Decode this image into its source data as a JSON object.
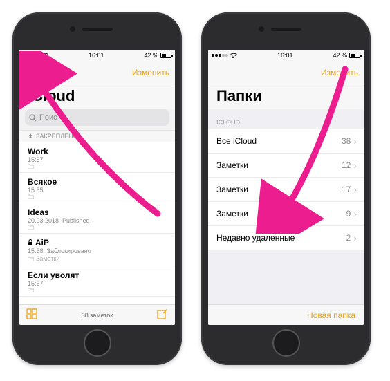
{
  "status": {
    "time": "16:01",
    "battery": "42 %"
  },
  "left": {
    "nav": {
      "edit": "Изменить"
    },
    "title": "iCloud",
    "search": {
      "placeholder": "Поис"
    },
    "pinned_header": "ЗАКРЕПЛЕНО",
    "notes": [
      {
        "title": "Work",
        "time": "15:57",
        "extra": "",
        "locked": false
      },
      {
        "title": "Всякое",
        "time": "15:55",
        "extra": "",
        "locked": false
      },
      {
        "title": "Ideas",
        "time": "20.03.2018",
        "extra": "Published",
        "locked": false
      },
      {
        "title": "AiP",
        "time": "15:58",
        "extra": "Заблокировано",
        "locked": true,
        "folder": "Заметки"
      },
      {
        "title": "Если уволят",
        "time": "15:57",
        "extra": "",
        "locked": false
      }
    ],
    "footer": {
      "count": "38 заметок"
    }
  },
  "right": {
    "nav": {
      "edit": "Изменить"
    },
    "title": "Папки",
    "section": "ICLOUD",
    "folders": [
      {
        "name": "Все iCloud",
        "count": "38"
      },
      {
        "name": "Заметки",
        "count": "12"
      },
      {
        "name": "Заметки",
        "count": "17"
      },
      {
        "name": "Заметки",
        "count": "9"
      },
      {
        "name": "Недавно удаленные",
        "count": "2"
      }
    ],
    "footer": {
      "new_folder": "Новая папка"
    }
  }
}
